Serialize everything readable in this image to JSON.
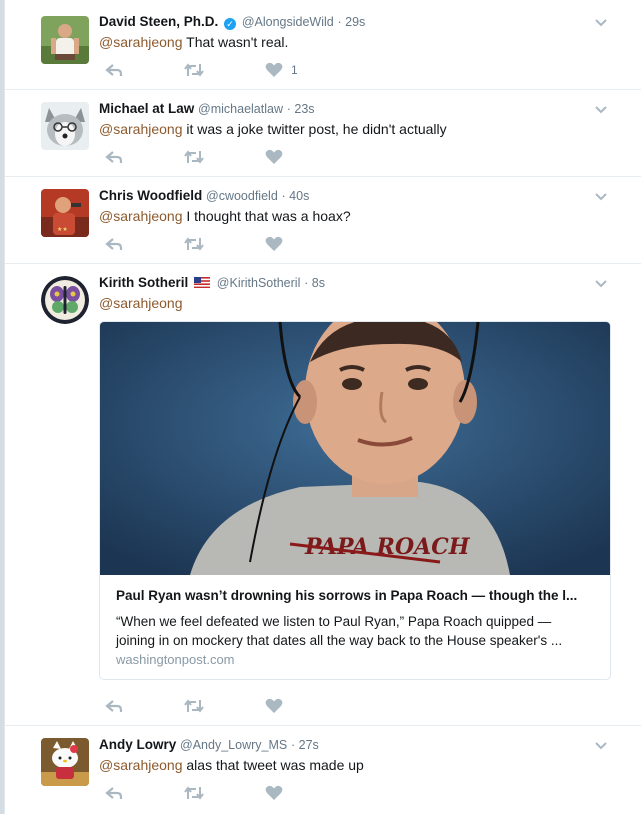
{
  "timeline": {
    "tweets": [
      {
        "fullname": "David Steen, Ph.D.",
        "verified": true,
        "screen_name": "@AlongsideWild",
        "time": "· 29s",
        "mention": "@sarahjeong",
        "text": " That wasn't real.",
        "like_count": "1",
        "avatar_icon": "person-avatar"
      },
      {
        "fullname": "Michael at Law",
        "verified": false,
        "screen_name": "@michaelatlaw",
        "time": "· 23s",
        "mention": "@sarahjeong",
        "text": " it was a joke twitter post, he didn't actually",
        "like_count": "",
        "avatar_icon": "husky-dog-avatar"
      },
      {
        "fullname": "Chris Woodfield",
        "verified": false,
        "screen_name": "@cwoodfield",
        "time": "· 40s",
        "mention": "@sarahjeong",
        "text": " I thought that was a hoax?",
        "like_count": "",
        "avatar_icon": "person-avatar"
      },
      {
        "fullname": "Kirith Sotheril",
        "verified": false,
        "has_flag": true,
        "flag_icon": "us-flag-icon",
        "screen_name": "@KirithSotheril",
        "time": "· 8s",
        "mention": "@sarahjeong",
        "text": "",
        "like_count": "",
        "avatar_icon": "butterfly-emblem-avatar",
        "card": {
          "title": "Paul Ryan wasn’t drowning his sorrows in Papa Roach — though the l...",
          "description_line1": "“When we feel defeated we listen to Paul Ryan,” Papa Roach quipped —",
          "description_line2": "joining in on mockery that dates all the way back to the House speaker's ...",
          "domain": "washingtonpost.com",
          "image_shirt_text": "PAPA ROACH"
        }
      },
      {
        "fullname": "Andy Lowry",
        "verified": false,
        "screen_name": "@Andy_Lowry_MS",
        "time": "· 27s",
        "mention": "@sarahjeong",
        "text": " alas that tweet was made up",
        "like_count": "",
        "avatar_icon": "hello-kitty-avatar"
      }
    ]
  },
  "colors": {
    "mention": "#8d5a2d",
    "secondary_text": "#657786",
    "icon": "#aab8c2",
    "verified": "#1da1f2"
  },
  "icons": {
    "reply": "reply-icon",
    "retweet": "retweet-icon",
    "like": "heart-icon",
    "more": "chevron-down-icon"
  }
}
